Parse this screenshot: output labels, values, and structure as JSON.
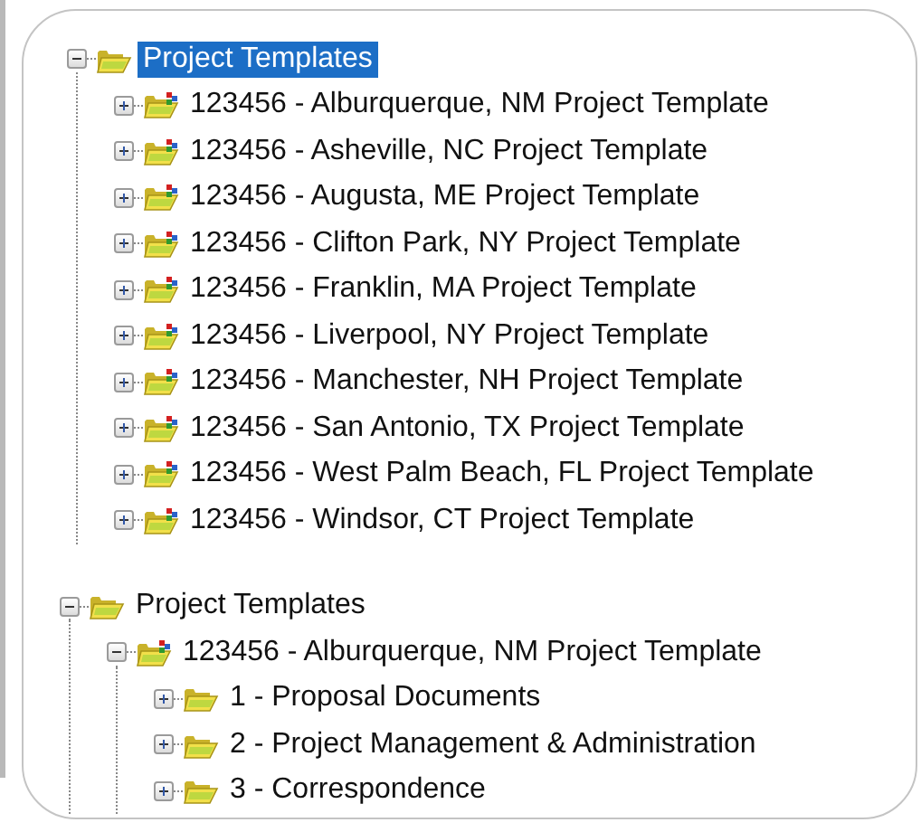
{
  "trees": [
    {
      "label": "Project Templates",
      "kind": "folder",
      "expanded": true,
      "selected": true,
      "children": [
        {
          "label": "123456 - Alburquerque, NM Project Template",
          "kind": "template",
          "expanded": false,
          "selected": false
        },
        {
          "label": "123456 - Asheville, NC Project Template",
          "kind": "template",
          "expanded": false,
          "selected": false
        },
        {
          "label": "123456 - Augusta, ME Project Template",
          "kind": "template",
          "expanded": false,
          "selected": false
        },
        {
          "label": "123456 - Clifton Park, NY Project Template",
          "kind": "template",
          "expanded": false,
          "selected": false
        },
        {
          "label": "123456 - Franklin, MA Project Template",
          "kind": "template",
          "expanded": false,
          "selected": false
        },
        {
          "label": "123456 - Liverpool, NY Project Template",
          "kind": "template",
          "expanded": false,
          "selected": false
        },
        {
          "label": "123456 - Manchester, NH Project Template",
          "kind": "template",
          "expanded": false,
          "selected": false
        },
        {
          "label": "123456 - San Antonio, TX Project Template",
          "kind": "template",
          "expanded": false,
          "selected": false
        },
        {
          "label": "123456 - West Palm Beach, FL Project Template",
          "kind": "template",
          "expanded": false,
          "selected": false
        },
        {
          "label": "123456 - Windsor, CT Project Template",
          "kind": "template",
          "expanded": false,
          "selected": false
        }
      ]
    },
    {
      "label": "Project Templates",
      "kind": "folder",
      "expanded": true,
      "selected": false,
      "children": [
        {
          "label": "123456 - Alburquerque, NM Project Template",
          "kind": "template",
          "expanded": true,
          "selected": false,
          "children": [
            {
              "label": "1 - Proposal Documents",
              "kind": "folder",
              "expanded": false,
              "selected": false
            },
            {
              "label": "2 - Project Management & Administration",
              "kind": "folder",
              "expanded": false,
              "selected": false
            },
            {
              "label": "3 - Correspondence",
              "kind": "folder",
              "expanded": false,
              "selected": false
            }
          ]
        }
      ]
    }
  ]
}
